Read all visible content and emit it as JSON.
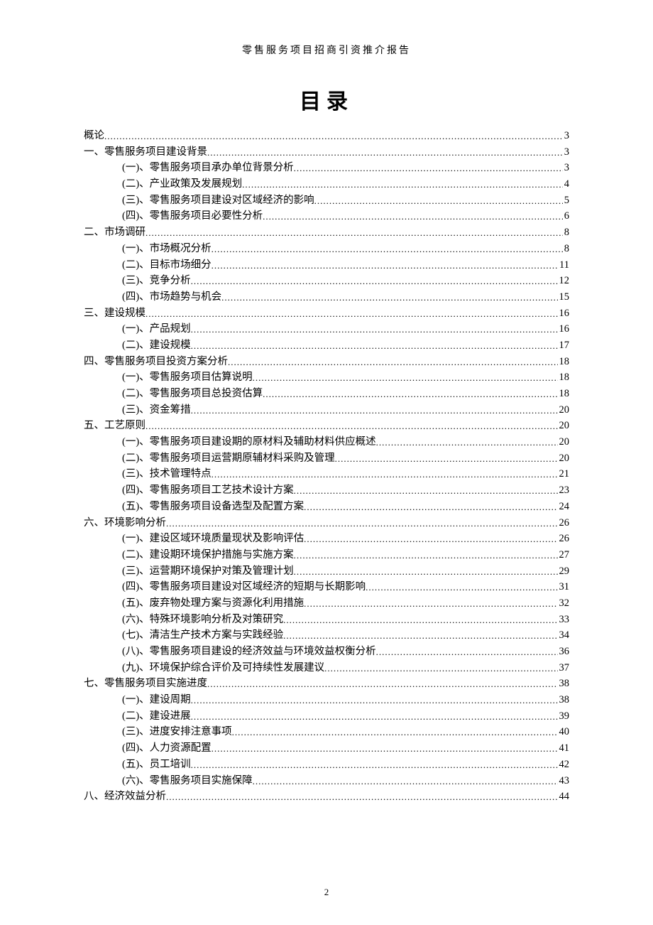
{
  "header": "零售服务项目招商引资推介报告",
  "title": "目录",
  "page_number": "2",
  "toc": [
    {
      "level": 0,
      "label": "概论",
      "page": "3"
    },
    {
      "level": 0,
      "label": "一、零售服务项目建设背景",
      "page": "3"
    },
    {
      "level": 1,
      "label": "(一)、零售服务项目承办单位背景分析",
      "page": "3"
    },
    {
      "level": 1,
      "label": "(二)、产业政策及发展规划",
      "page": "4"
    },
    {
      "level": 1,
      "label": "(三)、零售服务项目建设对区域经济的影响",
      "page": "5"
    },
    {
      "level": 1,
      "label": "(四)、零售服务项目必要性分析",
      "page": "6"
    },
    {
      "level": 0,
      "label": "二、市场调研",
      "page": "8"
    },
    {
      "level": 1,
      "label": "(一)、市场概况分析",
      "page": "8"
    },
    {
      "level": 1,
      "label": "(二)、目标市场细分",
      "page": "11"
    },
    {
      "level": 1,
      "label": "(三)、竞争分析",
      "page": "12"
    },
    {
      "level": 1,
      "label": "(四)、市场趋势与机会",
      "page": "15"
    },
    {
      "level": 0,
      "label": "三、建设规模",
      "page": "16"
    },
    {
      "level": 1,
      "label": "(一)、产品规划",
      "page": "16"
    },
    {
      "level": 1,
      "label": "(二)、建设规模",
      "page": "17"
    },
    {
      "level": 0,
      "label": "四、零售服务项目投资方案分析",
      "page": "18"
    },
    {
      "level": 1,
      "label": "(一)、零售服务项目估算说明",
      "page": "18"
    },
    {
      "level": 1,
      "label": "(二)、零售服务项目总投资估算",
      "page": "18"
    },
    {
      "level": 1,
      "label": "(三)、资金筹措",
      "page": "20"
    },
    {
      "level": 0,
      "label": "五、工艺原则",
      "page": "20"
    },
    {
      "level": 1,
      "label": "(一)、零售服务项目建设期的原材料及辅助材料供应概述",
      "page": "20"
    },
    {
      "level": 1,
      "label": "(二)、零售服务项目运营期原辅材料采购及管理",
      "page": "20"
    },
    {
      "level": 1,
      "label": "(三)、技术管理特点",
      "page": "21"
    },
    {
      "level": 1,
      "label": "(四)、零售服务项目工艺技术设计方案",
      "page": "23"
    },
    {
      "level": 1,
      "label": "(五)、零售服务项目设备选型及配置方案",
      "page": "24"
    },
    {
      "level": 0,
      "label": "六、环境影响分析",
      "page": "26"
    },
    {
      "level": 1,
      "label": "(一)、建设区域环境质量现状及影响评估",
      "page": "26"
    },
    {
      "level": 1,
      "label": "(二)、建设期环境保护措施与实施方案",
      "page": "27"
    },
    {
      "level": 1,
      "label": "(三)、运营期环境保护对策及管理计划",
      "page": "29"
    },
    {
      "level": 1,
      "label": "(四)、零售服务项目建设对区域经济的短期与长期影响",
      "page": "31"
    },
    {
      "level": 1,
      "label": "(五)、废弃物处理方案与资源化利用措施",
      "page": "32"
    },
    {
      "level": 1,
      "label": "(六)、特殊环境影响分析及对策研究",
      "page": "33"
    },
    {
      "level": 1,
      "label": "(七)、清洁生产技术方案与实践经验",
      "page": "34"
    },
    {
      "level": 1,
      "label": "(八)、零售服务项目建设的经济效益与环境效益权衡分析",
      "page": "36"
    },
    {
      "level": 1,
      "label": "(九)、环境保护综合评价及可持续性发展建议",
      "page": "37"
    },
    {
      "level": 0,
      "label": "七、零售服务项目实施进度",
      "page": "38"
    },
    {
      "level": 1,
      "label": "(一)、建设周期",
      "page": "38"
    },
    {
      "level": 1,
      "label": "(二)、建设进展",
      "page": "39"
    },
    {
      "level": 1,
      "label": "(三)、进度安排注意事项",
      "page": "40"
    },
    {
      "level": 1,
      "label": "(四)、人力资源配置",
      "page": "41"
    },
    {
      "level": 1,
      "label": "(五)、员工培训",
      "page": "42"
    },
    {
      "level": 1,
      "label": "(六)、零售服务项目实施保障",
      "page": "43"
    },
    {
      "level": 0,
      "label": "八、经济效益分析",
      "page": "44"
    }
  ]
}
